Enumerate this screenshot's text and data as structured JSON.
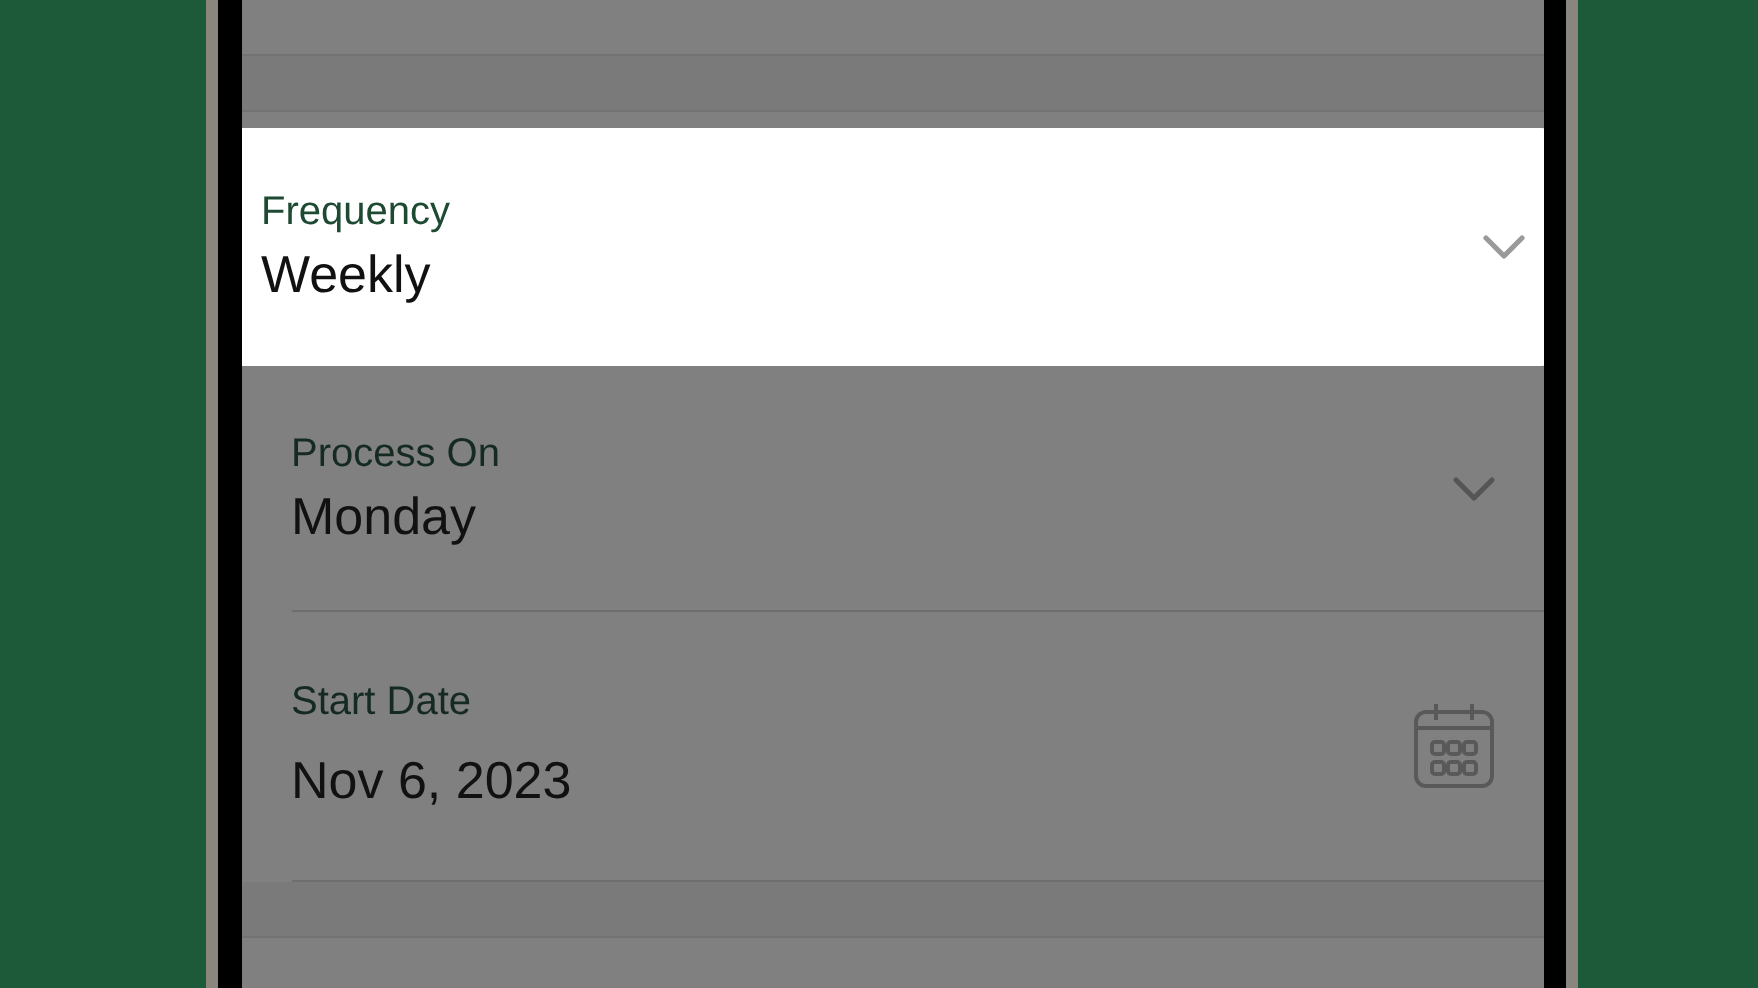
{
  "highlighted_field": {
    "label": "Frequency",
    "value": "Weekly",
    "kind": "dropdown"
  },
  "fields": [
    {
      "label": "Process On",
      "value": "Monday",
      "kind": "dropdown"
    },
    {
      "label": "Start Date",
      "value": "Nov 6, 2023",
      "kind": "date"
    }
  ]
}
